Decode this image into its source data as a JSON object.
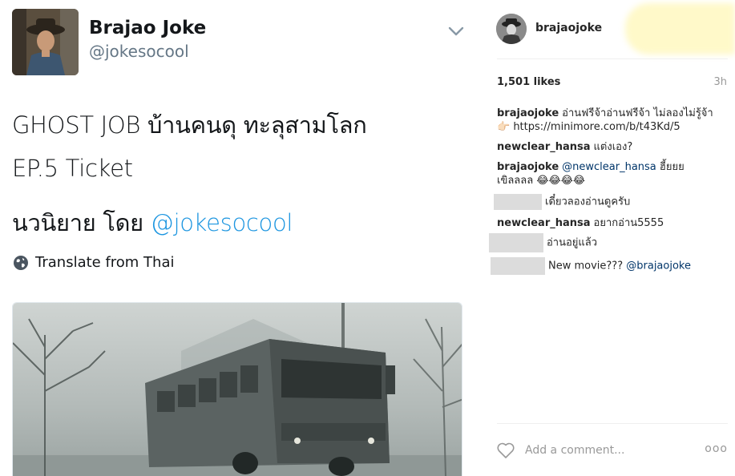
{
  "tweet": {
    "name": "Brajao Joke",
    "handle": "@jokesocool",
    "line1": "GHOST JOB บ้านคนดุ ทะลุสามโลก",
    "line2": "EP.5 Ticket",
    "line3_text": "นวนิยาย โดย ",
    "line3_mention": "@jokesocool",
    "translate": "Translate from Thai"
  },
  "instagram": {
    "username": "brajaojoke",
    "likes": "1,501 likes",
    "time": "3h",
    "comments": [
      {
        "user": "brajaojoke",
        "text": "อ่านฟรีจ้าอ่านฟรีจ้า ไม่ลองไม่รู้จ้า",
        "text2": "👉🏻 https://minimore.com/b/t43Kd/5"
      },
      {
        "user": "newclear_hansa",
        "text": "แต่งเอง?"
      },
      {
        "user": "brajaojoke",
        "mention": "@newclear_hansa",
        "text": " ฮี้ยยย",
        "text2": "เขิลลลล 😂😂😂😂"
      },
      {
        "user": "",
        "text": "เดี๋ยวลองอ่านดูครับ"
      },
      {
        "user": "newclear_hansa",
        "text": "อยากอ่าน5555"
      },
      {
        "user": "",
        "text": "อ่านอยู่แล้ว"
      },
      {
        "user": "",
        "text": "New movie??? ",
        "mention": "@brajaojoke"
      }
    ],
    "add_comment_placeholder": "Add a comment...",
    "more": "ooo"
  }
}
